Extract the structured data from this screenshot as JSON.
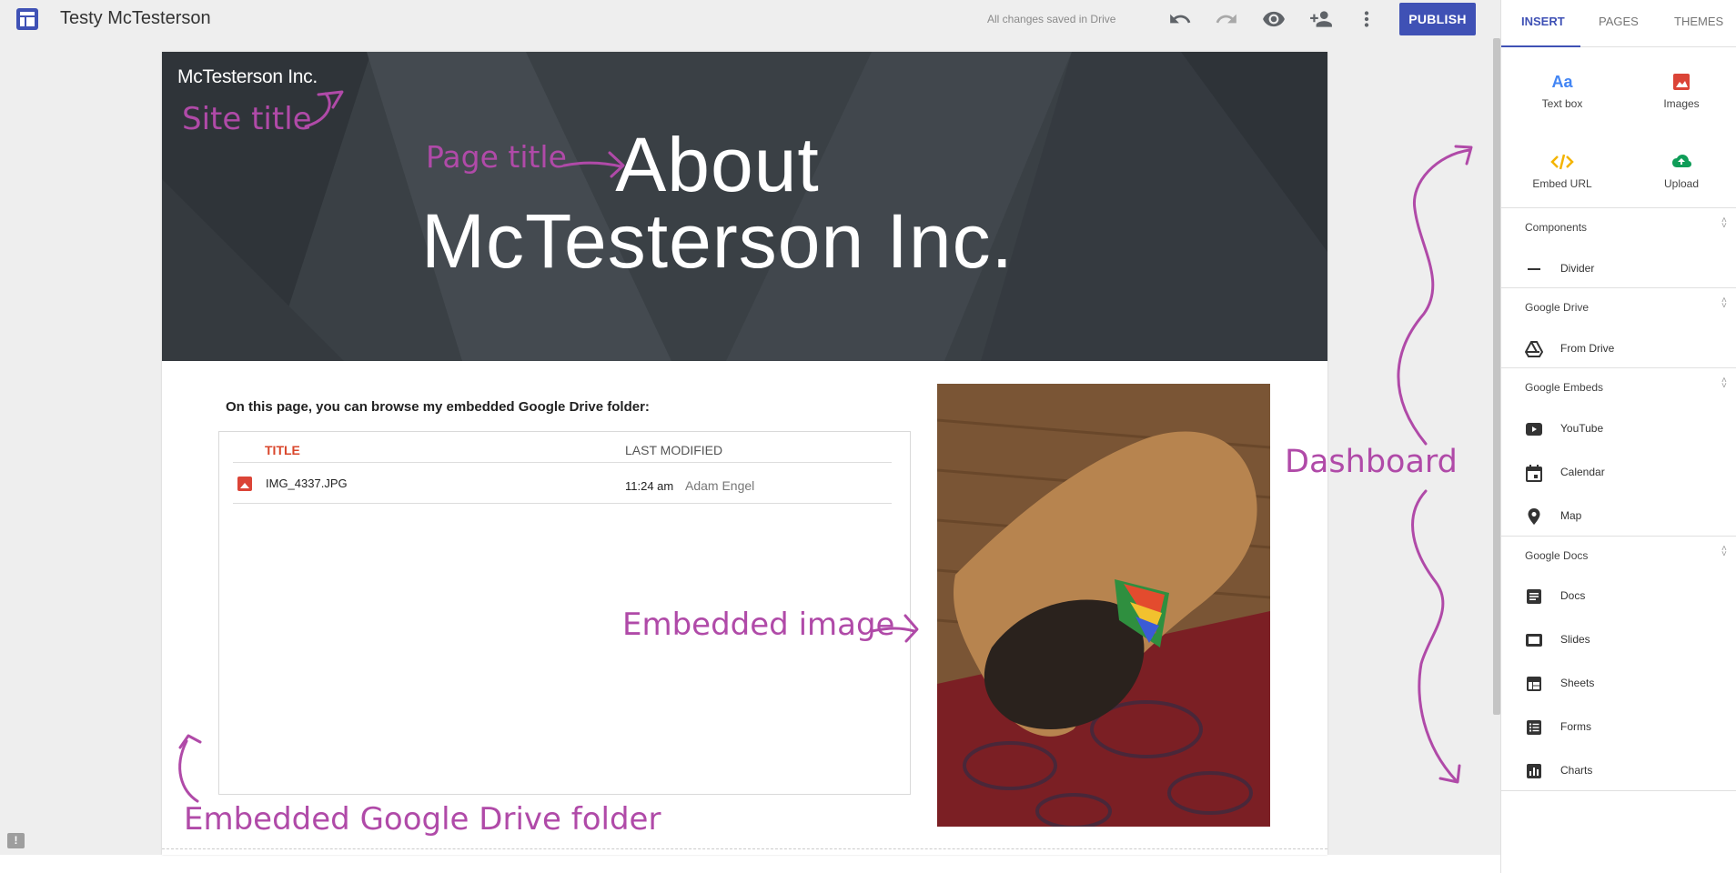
{
  "topbar": {
    "site_name": "Testy McTesterson",
    "save_status": "All changes saved in Drive",
    "publish_label": "PUBLISH"
  },
  "site": {
    "header_site_title": "McTesterson Inc.",
    "page_title_line1": "About",
    "page_title_line2": "McTesterson Inc.",
    "intro_text": "On this page, you can browse my embedded Google Drive folder:"
  },
  "drive_folder": {
    "columns": [
      "TITLE",
      "LAST MODIFIED"
    ],
    "files": [
      {
        "name": "IMG_4337.JPG",
        "time": "11:24 am",
        "owner": "Adam Engel"
      }
    ]
  },
  "panel": {
    "tabs": [
      "INSERT",
      "PAGES",
      "THEMES"
    ],
    "active_tab": "INSERT",
    "insert_buttons": [
      {
        "label": "Text box",
        "icon": "text-box-icon",
        "color": "#4285f4"
      },
      {
        "label": "Images",
        "icon": "image-icon",
        "color": "#db4437"
      },
      {
        "label": "Embed URL",
        "icon": "code-icon",
        "color": "#f4b400"
      },
      {
        "label": "Upload",
        "icon": "cloud-upload-icon",
        "color": "#0f9d58"
      }
    ],
    "sections": [
      {
        "title": "Components",
        "items": [
          {
            "label": "Divider",
            "icon": "divider-icon"
          }
        ]
      },
      {
        "title": "Google Drive",
        "items": [
          {
            "label": "From Drive",
            "icon": "drive-icon"
          }
        ]
      },
      {
        "title": "Google Embeds",
        "items": [
          {
            "label": "YouTube",
            "icon": "youtube-icon"
          },
          {
            "label": "Calendar",
            "icon": "calendar-icon"
          },
          {
            "label": "Map",
            "icon": "map-pin-icon"
          }
        ]
      },
      {
        "title": "Google Docs",
        "items": [
          {
            "label": "Docs",
            "icon": "docs-icon"
          },
          {
            "label": "Slides",
            "icon": "slides-icon"
          },
          {
            "label": "Sheets",
            "icon": "sheets-icon"
          },
          {
            "label": "Forms",
            "icon": "forms-icon"
          },
          {
            "label": "Charts",
            "icon": "charts-icon"
          }
        ]
      }
    ]
  },
  "annotations": {
    "site_title": "Site title",
    "page_title": "Page title",
    "embedded_image": "Embedded image",
    "dashboard": "Dashboard",
    "embedded_drive_folder": "Embedded Google Drive folder"
  },
  "colors": {
    "accent": "#3f51b5",
    "annotation": "#b04aa8",
    "header_bg": "#3a4045",
    "drive_title_col": "#d9462b"
  }
}
